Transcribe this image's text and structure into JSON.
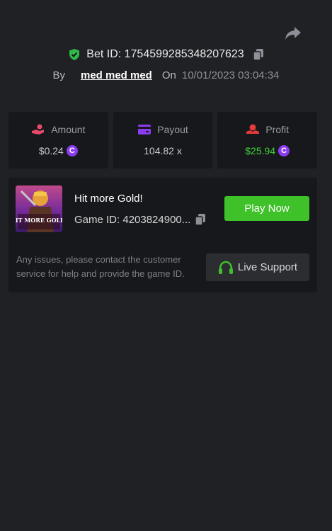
{
  "header": {
    "share_icon": "share-arrow-icon",
    "bet_id_label": "Bet ID: 1754599285348207623",
    "by_label": "By",
    "username": "med med med",
    "on_label": "On",
    "date": "10/01/2023 03:04:34"
  },
  "stats": [
    {
      "label": "Amount",
      "value": "$0.24",
      "icon": "hand-coin-icon",
      "coin": true,
      "color": "#e84a6a"
    },
    {
      "label": "Payout",
      "value": "104.82 x",
      "icon": "card-icon",
      "coin": false,
      "color": "#8b3cf0"
    },
    {
      "label": "Profit",
      "value": "$25.94",
      "icon": "hand-money-icon",
      "coin": true,
      "color": "#e23b3b",
      "value_color": "#3fd13a"
    }
  ],
  "coin_glyph": "C",
  "game": {
    "title": "Hit more Gold!",
    "game_id_label": "Game ID: 4203824900...",
    "play_button": "Play Now",
    "thumbnail_text": "HIT MORE GOLD!",
    "help_text": "Any issues, please contact the customer service for help and provide the game ID.",
    "support_button": "Live Support"
  },
  "colors": {
    "background": "#202125",
    "card": "#17181b",
    "accent_green": "#3fc12a",
    "coin_purple": "#8b3cf0"
  }
}
